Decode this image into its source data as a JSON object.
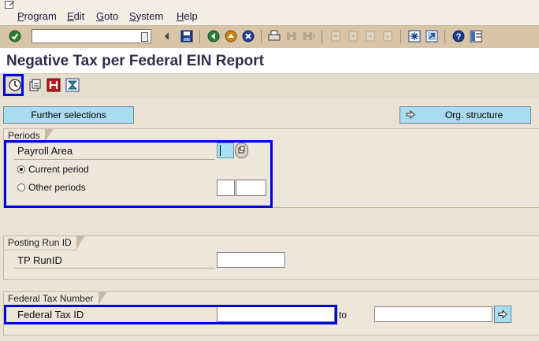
{
  "menu": {
    "items": [
      {
        "key": "P",
        "rest": "rogram"
      },
      {
        "key": "E",
        "rest": "dit"
      },
      {
        "key": "G",
        "rest": "oto"
      },
      {
        "key": "S",
        "rest": "ystem"
      },
      {
        "key": "H",
        "rest": "elp"
      }
    ]
  },
  "command_field": {
    "value": ""
  },
  "title": "Negative Tax per Federal EIN Report",
  "buttons": {
    "further_selections": "Further selections",
    "org_structure": "Org. structure"
  },
  "periods": {
    "section_title": "Periods",
    "payroll_area_label": "Payroll Area",
    "payroll_area_value": "",
    "current_period_label": "Current period",
    "current_period_selected": true,
    "other_periods_label": "Other periods",
    "other_periods_selected": false
  },
  "posting_run": {
    "section_title": "Posting Run ID",
    "tp_runid_label": "TP RunID",
    "tp_runid_value": ""
  },
  "federal_tax": {
    "section_title": "Federal Tax Number",
    "federal_tax_id_label": "Federal Tax ID",
    "from_value": "",
    "to_label": "to",
    "to_value": ""
  },
  "colors": {
    "highlight": "#0000e6",
    "title": "#2e2d4d",
    "button": "#a9dcee"
  }
}
